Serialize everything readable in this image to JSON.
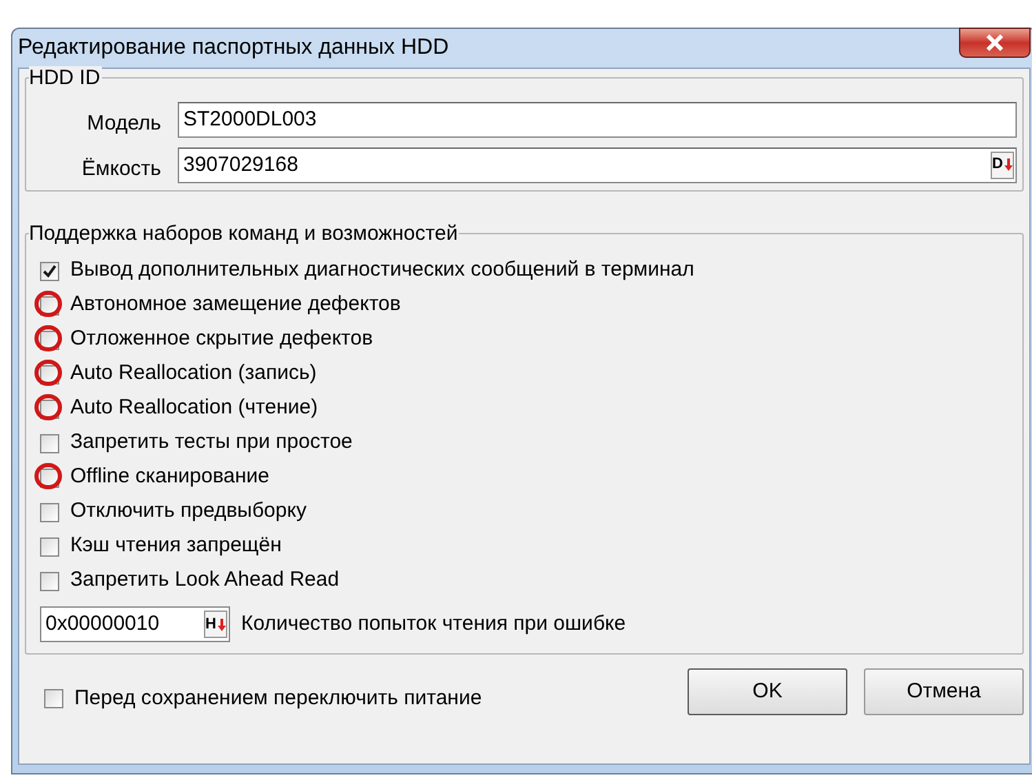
{
  "window": {
    "title": "Редактирование паспортных данных HDD"
  },
  "hdd_id": {
    "legend": "HDD ID",
    "fields": [
      {
        "label": "Модель",
        "value": "ST2000DL003"
      },
      {
        "label": "Ёмкость",
        "value": "3907029168",
        "button_label": "D"
      }
    ]
  },
  "features": {
    "legend": "Поддержка наборов команд и возможностей",
    "options": [
      {
        "label": "Вывод дополнительных диагностических сообщений в терминал",
        "checked": true,
        "circled": false
      },
      {
        "label": "Автономное замещение дефектов",
        "checked": false,
        "circled": true
      },
      {
        "label": "Отложенное скрытие дефектов",
        "checked": false,
        "circled": true
      },
      {
        "label": "Auto Reallocation (запись)",
        "checked": false,
        "circled": true
      },
      {
        "label": "Auto Reallocation (чтение)",
        "checked": false,
        "circled": true
      },
      {
        "label": "Запретить тесты при простое",
        "checked": false,
        "circled": false
      },
      {
        "label": "Offline сканирование",
        "checked": false,
        "circled": true
      },
      {
        "label": "Отключить предвыборку",
        "checked": false,
        "circled": false
      },
      {
        "label": "Кэш чтения запрещён",
        "checked": false,
        "circled": false
      },
      {
        "label": "Запретить Look Ahead Read",
        "checked": false,
        "circled": false
      }
    ],
    "retry": {
      "value": "0x00000010",
      "button_label": "H",
      "label": "Количество попыток чтения при ошибке"
    }
  },
  "footer": {
    "power_cycle": {
      "label": "Перед сохранением переключить питание",
      "checked": false
    },
    "buttons": [
      {
        "label": "OK"
      },
      {
        "label": "Отмена"
      }
    ]
  }
}
